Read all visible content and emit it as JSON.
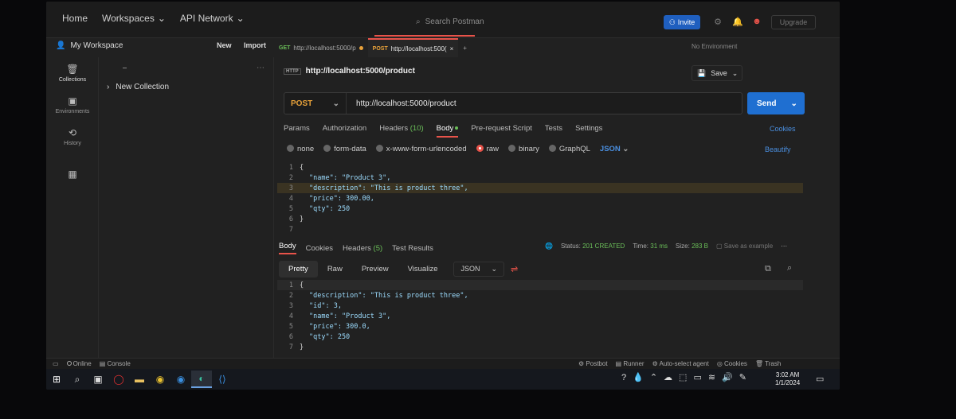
{
  "topbar": {
    "nav": [
      "Home",
      "Workspaces",
      "API Network"
    ],
    "search_placeholder": "Search Postman",
    "invite_label": "Invite",
    "upgrade_label": "Upgrade"
  },
  "workspace": {
    "title": "My Workspace",
    "new_label": "New",
    "import_label": "Import"
  },
  "tabs": [
    {
      "method": "GET",
      "label": "http://localhost:5000/p"
    },
    {
      "method": "POST",
      "label": "http://localhost:500("
    }
  ],
  "environment": "No Environment",
  "rail": {
    "collections": "Collections",
    "environments": "Environments",
    "history": "History"
  },
  "sidebar": {
    "collection_name": "New Collection"
  },
  "request": {
    "badge": "HTTP",
    "title": "http://localhost:5000/product",
    "save_label": "Save",
    "method": "POST",
    "url": "http://localhost:5000/product",
    "send_label": "Send",
    "tabs": {
      "params": "Params",
      "authorization": "Authorization",
      "headers": "Headers",
      "headers_count": "(10)",
      "body": "Body",
      "prerequest": "Pre-request Script",
      "tests": "Tests",
      "settings": "Settings"
    },
    "cookies_label": "Cookies",
    "body_options": {
      "none": "none",
      "form_data": "form-data",
      "urlencoded": "x-www-form-urlencoded",
      "raw": "raw",
      "binary": "binary",
      "graphql": "GraphQL",
      "format": "JSON"
    },
    "beautify_label": "Beautify",
    "body_lines": [
      {
        "n": "1",
        "t": "{"
      },
      {
        "n": "2",
        "t": "\"name\": \"Product 3\","
      },
      {
        "n": "3",
        "t": "\"description\": \"This is product three\","
      },
      {
        "n": "4",
        "t": "\"price\": 300.00,"
      },
      {
        "n": "5",
        "t": "\"qty\": 250"
      },
      {
        "n": "6",
        "t": "}"
      },
      {
        "n": "7",
        "t": ""
      }
    ]
  },
  "response": {
    "tabs": {
      "body": "Body",
      "cookies": "Cookies",
      "headers": "Headers",
      "headers_count": "(5)",
      "test_results": "Test Results"
    },
    "status_label": "Status:",
    "status_value": "201 CREATED",
    "time_label": "Time:",
    "time_value": "31 ms",
    "size_label": "Size:",
    "size_value": "283 B",
    "save_example": "Save as example",
    "views": [
      "Pretty",
      "Raw",
      "Preview",
      "Visualize"
    ],
    "format": "JSON",
    "lines": [
      {
        "n": "1",
        "t": "{"
      },
      {
        "n": "2",
        "t": "\"description\": \"This is product three\","
      },
      {
        "n": "3",
        "t": "\"id\": 3,"
      },
      {
        "n": "4",
        "t": "\"name\": \"Product 3\","
      },
      {
        "n": "5",
        "t": "\"price\": 300.0,"
      },
      {
        "n": "6",
        "t": "\"qty\": 250"
      },
      {
        "n": "7",
        "t": "}"
      }
    ]
  },
  "statusbar": {
    "online": "Online",
    "console": "Console",
    "postbot": "Postbot",
    "runner": "Runner",
    "auto_select": "Auto-select agent",
    "cookies": "Cookies",
    "trash": "Trash"
  },
  "taskbar": {
    "time": "3:02 AM",
    "date": "1/1/2024"
  },
  "colors": {
    "accent": "#e8534a",
    "send": "#1f6fd1",
    "post": "#e8a23a",
    "get": "#6bbf59",
    "link": "#4a8fe0"
  }
}
